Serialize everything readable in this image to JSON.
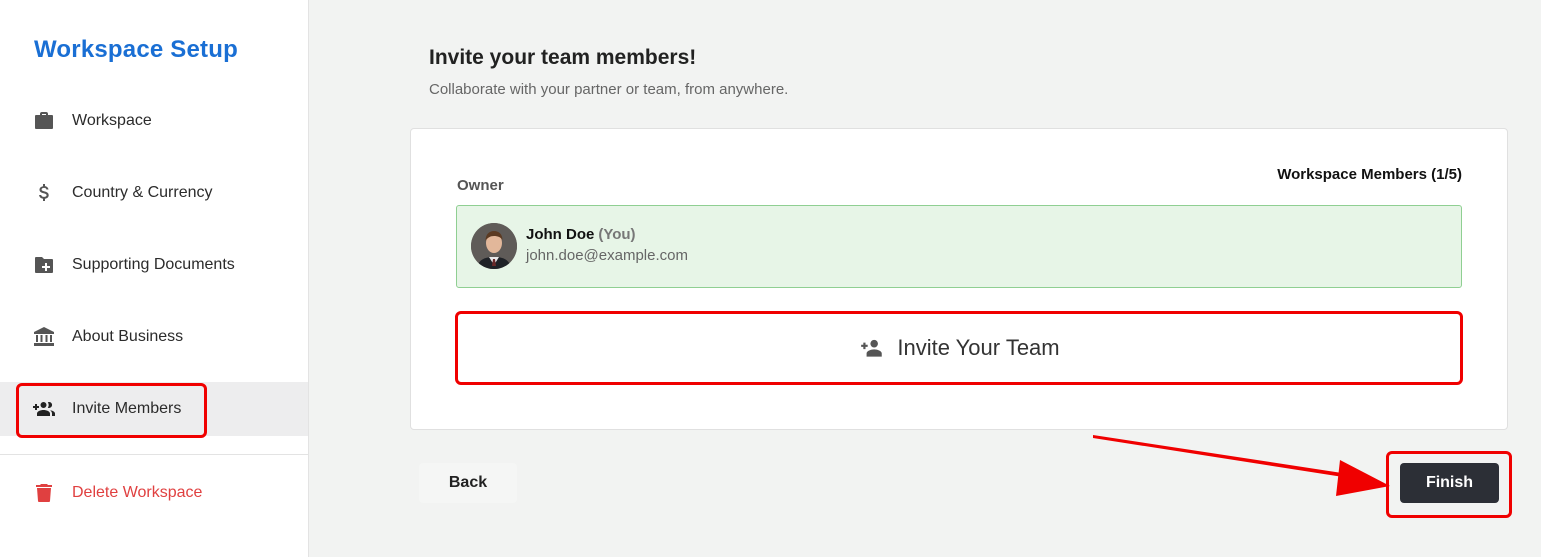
{
  "sidebar": {
    "title": "Workspace Setup",
    "items": [
      {
        "label": "Workspace",
        "icon": "briefcase-icon"
      },
      {
        "label": "Country & Currency",
        "icon": "dollar-icon"
      },
      {
        "label": "Supporting Documents",
        "icon": "folder-add-icon"
      },
      {
        "label": "About Business",
        "icon": "bank-icon"
      },
      {
        "label": "Invite Members",
        "icon": "group-add-icon",
        "active": true
      },
      {
        "label": "Delete Workspace",
        "icon": "trash-icon",
        "danger": true
      }
    ]
  },
  "main": {
    "title": "Invite your team members!",
    "subtitle": "Collaborate with your partner or team, from anywhere.",
    "owner_label": "Owner",
    "members_count": "Workspace Members (1/5)",
    "owner": {
      "name": "John Doe",
      "you_tag": "(You)",
      "email": "john.doe@example.com"
    },
    "invite_button_label": "Invite Your Team",
    "back_label": "Back",
    "finish_label": "Finish"
  },
  "colors": {
    "brand": "#1a6fd4",
    "danger": "#e04040",
    "annotation": "#f00000",
    "owner_bg": "#e7f5e7",
    "finish_bg": "#2c2f36"
  }
}
